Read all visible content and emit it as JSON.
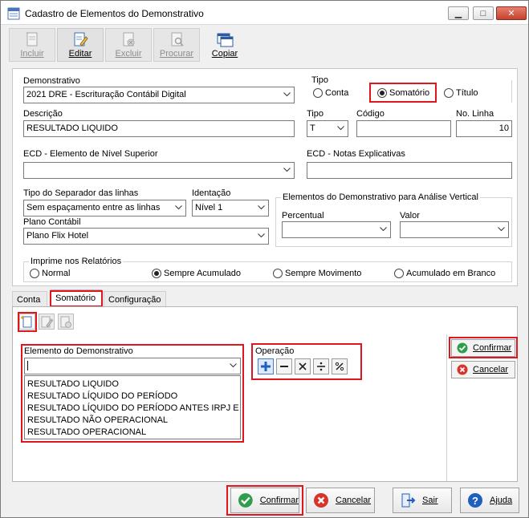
{
  "window": {
    "title": "Cadastro de Elementos do Demonstrativo"
  },
  "toolbar": {
    "incluir": "Incluir",
    "editar": "Editar",
    "excluir": "Excluir",
    "procurar": "Procurar",
    "copiar": "Copiar"
  },
  "form": {
    "demonstrativo_label": "Demonstrativo",
    "demonstrativo_value": "2021 DRE - Escrituração Contábil Digital",
    "tipo_group_label": "Tipo",
    "tipo_conta": "Conta",
    "tipo_somatorio": "Somatório",
    "tipo_titulo": "Título",
    "descricao_label": "Descrição",
    "descricao_value": "RESULTADO LIQUIDO",
    "tipo_label": "Tipo",
    "tipo_value": "T",
    "codigo_label": "Código",
    "codigo_value": "",
    "nolinha_label": "No. Linha",
    "nolinha_value": "10",
    "ecd_superior_label": "ECD - Elemento de Nível Superior",
    "ecd_superior_value": "",
    "ecd_notas_label": "ECD - Notas Explicativas",
    "ecd_notas_value": "",
    "separador_label": "Tipo do Separador das linhas",
    "separador_value": "Sem espaçamento entre as linhas",
    "identacao_label": "Identação",
    "identacao_value": "Nível 1",
    "plano_label": "Plano Contábil",
    "plano_value": "Plano Flix Hotel",
    "analise_group_label": "Elementos do Demonstrativo para Análise Vertical",
    "percentual_label": "Percentual",
    "percentual_value": "",
    "valor_label": "Valor",
    "valor_value": "",
    "imprime_group_label": "Imprime nos Relatórios",
    "imprime_normal": "Normal",
    "imprime_sempre_acumulado": "Sempre Acumulado",
    "imprime_sempre_movimento": "Sempre Movimento",
    "imprime_acumulado_branco": "Acumulado em Branco"
  },
  "tabs": [
    "Conta",
    "Somatório",
    "Configuração"
  ],
  "somatorio": {
    "elemento_label": "Elemento do Demonstrativo",
    "elemento_value": "",
    "options": [
      "RESULTADO LIQUIDO",
      "RESULTADO LÍQUIDO DO PERÍODO",
      "RESULTADO LÍQUIDO DO PERÍODO ANTES IRPJ E C",
      "RESULTADO NÃO OPERACIONAL",
      "RESULTADO OPERACIONAL"
    ],
    "operacao_label": "Operação",
    "confirmar": "Confirmar",
    "cancelar": "Cancelar"
  },
  "bottom": {
    "confirmar": "Confirmar",
    "cancelar": "Cancelar",
    "sair": "Sair",
    "ajuda": "Ajuda"
  },
  "colors": {
    "highlight": "#e0161e",
    "ok_green": "#2e9e4b",
    "cancel_red": "#d9342b",
    "accent_blue": "#1f5fbf"
  }
}
